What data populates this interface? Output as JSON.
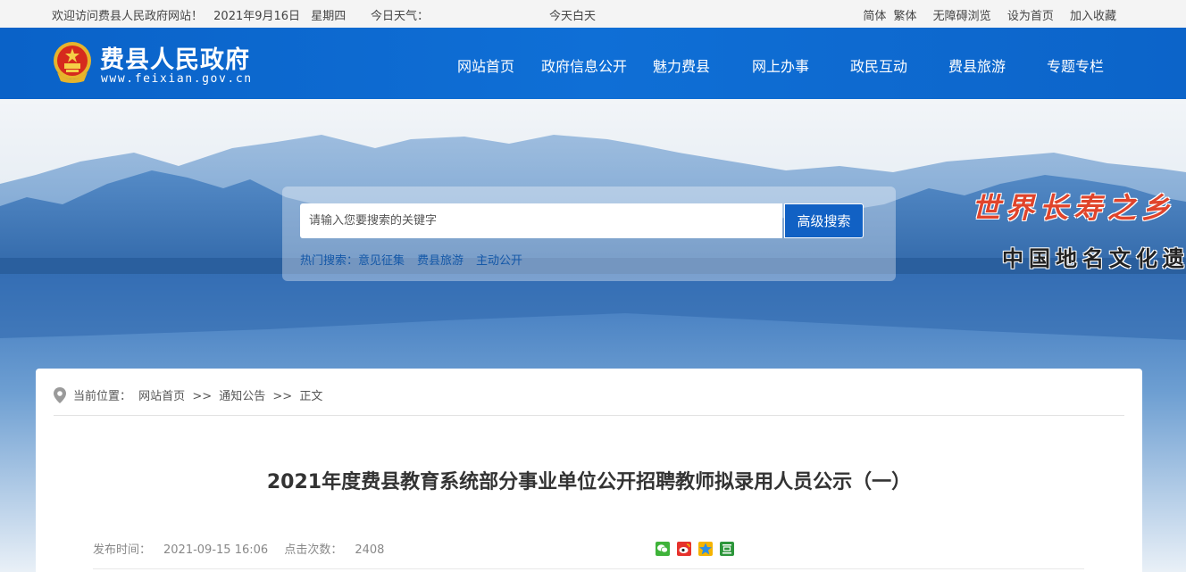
{
  "topbar": {
    "welcome": "欢迎访问费县人民政府网站！",
    "date": "2021年9月16日",
    "weekday": "星期四",
    "weather_label": "今日天气：",
    "weather_text": "今天白天",
    "links": [
      "简体",
      "繁体",
      "无障碍浏览",
      "设为首页",
      "加入收藏"
    ]
  },
  "header": {
    "site_name": "费县人民政府",
    "site_url": "www.feixian.gov.cn",
    "nav": [
      "网站首页",
      "政府信息公开",
      "魅力费县",
      "网上办事",
      "政民互动",
      "费县旅游",
      "专题专栏"
    ],
    "brand_color": "#0f6fd6"
  },
  "search": {
    "placeholder": "请输入您要搜索的关键字",
    "button": "高级搜索",
    "hot_label": "热门搜索：",
    "hot_links": [
      "意见征集",
      "费县旅游",
      "主动公开"
    ]
  },
  "banner": {
    "slogan1": "世界长寿之乡",
    "slogan2": "中国地名文化遗产"
  },
  "breadcrumb": {
    "label": "当前位置：",
    "items": [
      "网站首页",
      "通知公告",
      "正文"
    ],
    "separator": ">>"
  },
  "article": {
    "title": "2021年度费县教育系统部分事业单位公开招聘教师拟录用人员公示（一）",
    "publish_label": "发布时间：",
    "publish_time": "2021-09-15 16:06",
    "views_label": "点击次数：",
    "views": "2408",
    "share_icons": [
      "wechat-icon",
      "weibo-icon",
      "qzone-icon",
      "douban-icon"
    ]
  }
}
